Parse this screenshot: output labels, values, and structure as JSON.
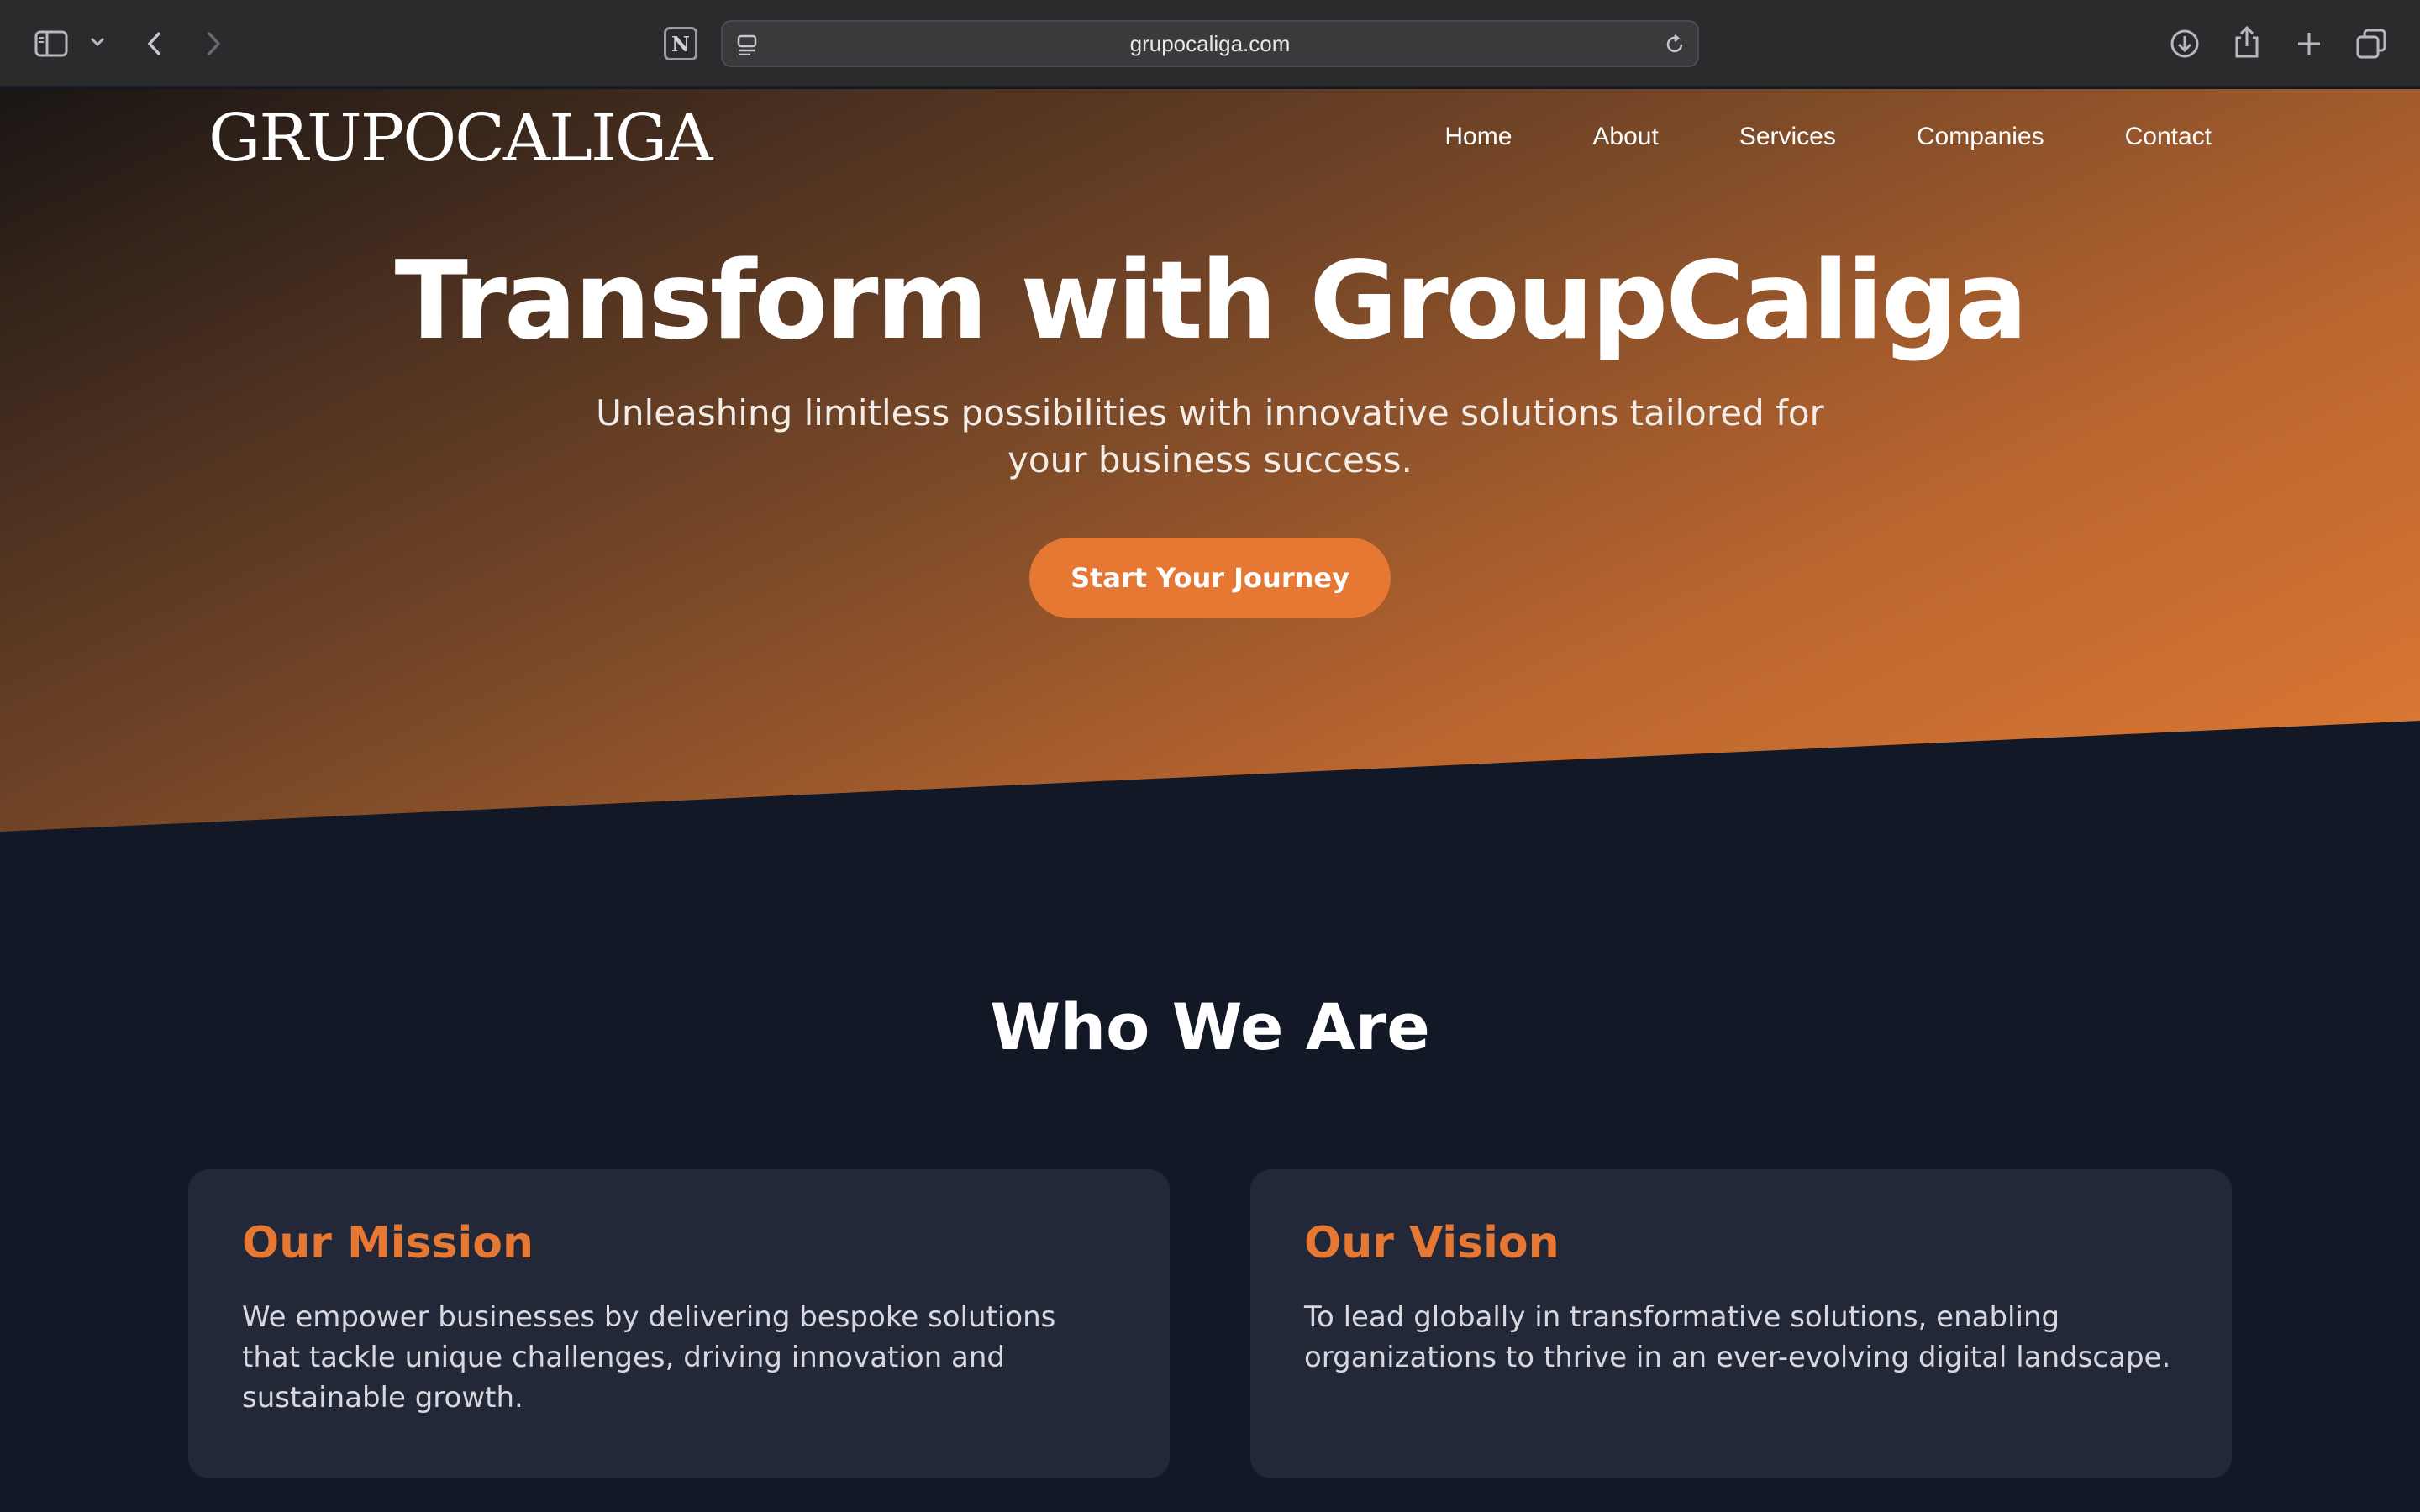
{
  "browser": {
    "url": "grupocaliga.com",
    "icons": [
      "sidebar-icon",
      "chevron-down-icon",
      "back-icon",
      "forward-icon",
      "notion-icon",
      "reader-icon",
      "reload-icon",
      "download-icon",
      "share-icon",
      "new-tab-icon",
      "tabs-overview-icon"
    ]
  },
  "site": {
    "logo": "GRUPOCALIGA",
    "nav": [
      "Home",
      "About",
      "Services",
      "Companies",
      "Contact"
    ],
    "hero": {
      "title": "Transform with GroupCaliga",
      "subtitle": "Unleashing limitless possibilities with innovative solutions tailored for your business success.",
      "cta": "Start Your Journey"
    },
    "about": {
      "title": "Who We Are",
      "cards": [
        {
          "title": "Our Mission",
          "text": "We empower businesses by delivering bespoke solutions that tackle unique challenges, driving innovation and sustainable growth."
        },
        {
          "title": "Our Vision",
          "text": "To lead globally in transformative solutions, enabling organizations to thrive in an ever-evolving digital landscape."
        }
      ]
    },
    "colors": {
      "accent": "#e67833",
      "background": "#121826",
      "card": "#222838"
    }
  }
}
